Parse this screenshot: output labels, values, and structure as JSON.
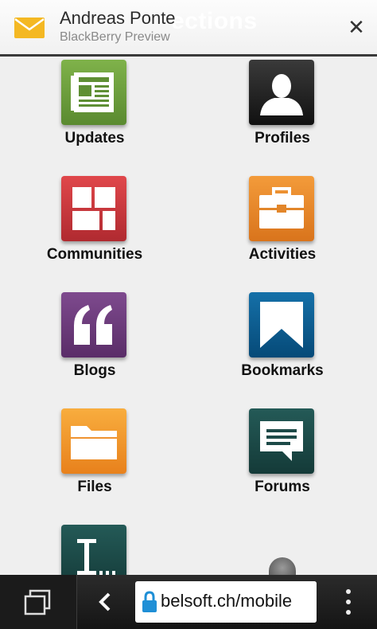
{
  "notification": {
    "page_title_behind": "ections",
    "sender": "Andreas Ponte",
    "source": "BlackBerry Preview",
    "close_symbol": "✕",
    "icon": "mail-icon"
  },
  "apps": [
    {
      "label": "Updates",
      "icon": "newspaper-icon",
      "color": "#6a9a3c"
    },
    {
      "label": "Profiles",
      "icon": "person-icon",
      "color": "#222222"
    },
    {
      "label": "Communities",
      "icon": "blocks-icon",
      "color": "#d0393e"
    },
    {
      "label": "Activities",
      "icon": "briefcase-icon",
      "color": "#e8882a"
    },
    {
      "label": "Blogs",
      "icon": "quote-icon",
      "color": "#6b3b7a"
    },
    {
      "label": "Bookmarks",
      "icon": "bookmark-icon",
      "color": "#0a5a8e"
    },
    {
      "label": "Files",
      "icon": "folder-icon",
      "color": "#f0962a"
    },
    {
      "label": "Forums",
      "icon": "speech-bubble-icon",
      "color": "#1d4a48"
    },
    {
      "label": "",
      "icon": "text-cursor-icon",
      "color": "#1d4a48"
    }
  ],
  "browser": {
    "url": "belsoft.ch/mobile",
    "back_symbol": "‹"
  }
}
